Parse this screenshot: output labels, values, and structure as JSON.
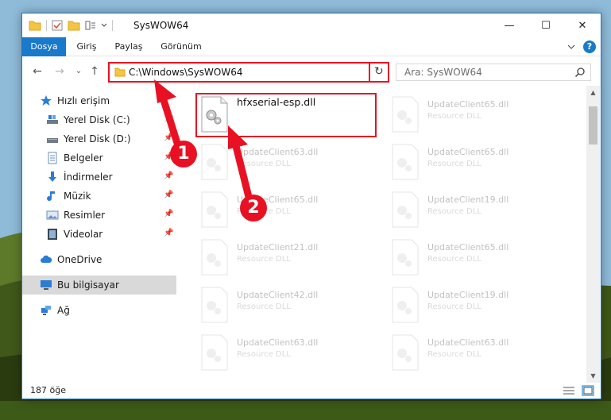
{
  "window": {
    "title": "SysWOW64",
    "minimize": "—",
    "maximize": "☐",
    "close": "✕"
  },
  "ribbon": {
    "tabs": [
      "Dosya",
      "Giriş",
      "Paylaş",
      "Görünüm"
    ],
    "help": "?"
  },
  "nav": {
    "back": "←",
    "forward": "→",
    "recent": "⌄",
    "up": "↑",
    "address": "C:\\Windows\\SysWOW64",
    "address_chevron": "⌄",
    "refresh": "↻",
    "search_placeholder": "Ara: SysWOW64"
  },
  "sidebar": {
    "items": [
      {
        "label": "Hızlı erişim",
        "icon": "star-icon"
      },
      {
        "label": "Yerel Disk (C:)",
        "icon": "drive-icon"
      },
      {
        "label": "Yerel Disk (D:)",
        "icon": "drive-icon"
      },
      {
        "label": "Belgeler",
        "icon": "documents-icon"
      },
      {
        "label": "İndirmeler",
        "icon": "download-icon"
      },
      {
        "label": "Müzik",
        "icon": "music-icon"
      },
      {
        "label": "Resimler",
        "icon": "pictures-icon"
      },
      {
        "label": "Videolar",
        "icon": "videos-icon"
      },
      {
        "label": "OneDrive",
        "icon": "cloud-icon"
      },
      {
        "label": "Bu bilgisayar",
        "icon": "computer-icon"
      },
      {
        "label": "Ağ",
        "icon": "network-icon"
      }
    ]
  },
  "files": [
    {
      "name": "hfxserial-esp.dll",
      "type": ""
    },
    {
      "name": "UpdateClient65.dll",
      "type": "Resource DLL"
    },
    {
      "name": "UpdateClient63.dll",
      "type": "Resource DLL"
    },
    {
      "name": "UpdateClient65.dll",
      "type": "Resource DLL"
    },
    {
      "name": "UpdateClient65.dll",
      "type": "Resource DLL"
    },
    {
      "name": "UpdateClient19.dll",
      "type": "Resource DLL"
    },
    {
      "name": "UpdateClient21.dll",
      "type": "Resource DLL"
    },
    {
      "name": "UpdateClient65.dll",
      "type": "Resource DLL"
    },
    {
      "name": "UpdateClient42.dll",
      "type": "Resource DLL"
    },
    {
      "name": "UpdateClient19.dll",
      "type": "Resource DLL"
    },
    {
      "name": "UpdateClient63.dll",
      "type": "Resource DLL"
    },
    {
      "name": "UpdateClient63.dll",
      "type": "Resource DLL"
    }
  ],
  "status": {
    "count": "187 öğe"
  },
  "callouts": [
    "1",
    "2"
  ],
  "colors": {
    "accent": "#1979ca",
    "annotation": "#e81123"
  }
}
